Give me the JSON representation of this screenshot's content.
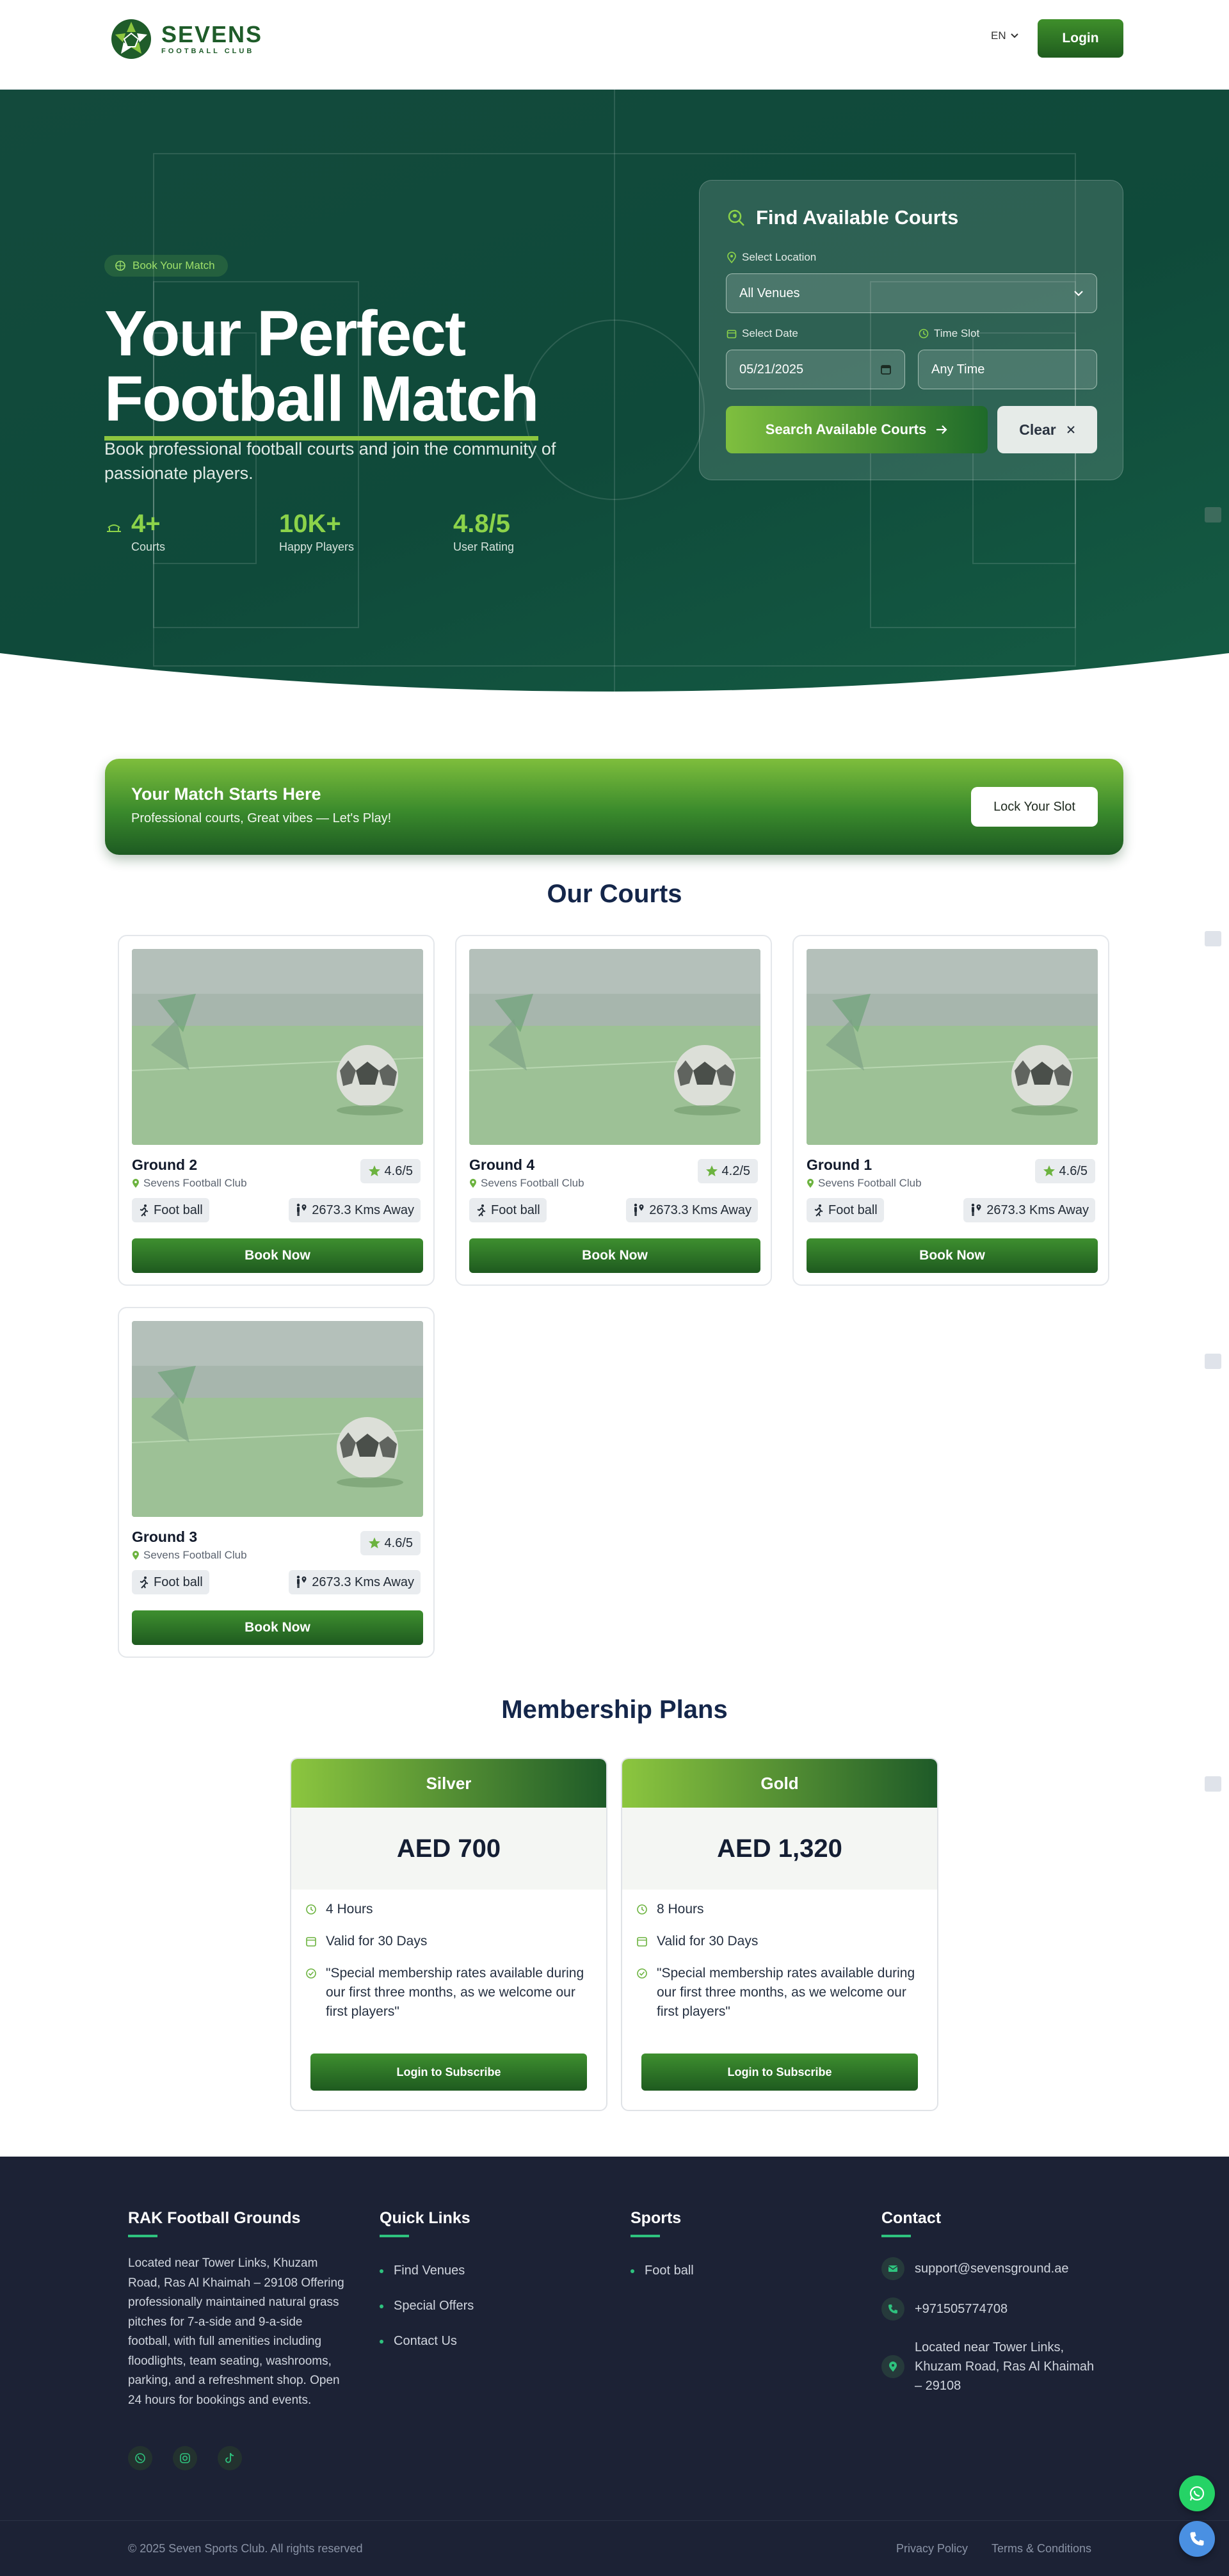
{
  "header": {
    "logo_title": "SEVENS",
    "logo_subtitle": "FOOTBALL CLUB",
    "language": "EN",
    "login_label": "Login"
  },
  "hero": {
    "pill": "Book Your Match",
    "title_line1": "Your Perfect",
    "title_line2": "Football Match",
    "subtitle": "Book professional football courts and join the community of passionate players.",
    "stats": [
      {
        "value": "4+",
        "label": "Courts"
      },
      {
        "value": "10K+",
        "label": "Happy Players"
      },
      {
        "value": "4.8/5",
        "label": "User Rating"
      }
    ]
  },
  "search": {
    "title": "Find Available Courts",
    "location_label": "Select Location",
    "location_value": "All Venues",
    "date_label": "Select Date",
    "date_value": "05/21/2025",
    "time_label": "Time Slot",
    "time_value": "Any Time",
    "search_label": "Search Available Courts",
    "clear_label": "Clear"
  },
  "banner": {
    "heading": "Your Match Starts Here",
    "subtext": "Professional courts, Great vibes — Let's Play!",
    "button": "Lock Your Slot"
  },
  "courts": {
    "title": "Our Courts",
    "items": [
      {
        "name": "Ground 2",
        "club": "Sevens Football Club",
        "rating": "4.6/5",
        "sport": "Foot ball",
        "distance": "2673.3 Kms Away",
        "book": "Book Now"
      },
      {
        "name": "Ground 4",
        "club": "Sevens Football Club",
        "rating": "4.2/5",
        "sport": "Foot ball",
        "distance": "2673.3 Kms Away",
        "book": "Book Now"
      },
      {
        "name": "Ground 1",
        "club": "Sevens Football Club",
        "rating": "4.6/5",
        "sport": "Foot ball",
        "distance": "2673.3 Kms Away",
        "book": "Book Now"
      },
      {
        "name": "Ground 3",
        "club": "Sevens Football Club",
        "rating": "4.6/5",
        "sport": "Foot ball",
        "distance": "2673.3 Kms Away",
        "book": "Book Now"
      }
    ]
  },
  "plans": {
    "title": "Membership Plans",
    "items": [
      {
        "name": "Silver",
        "price": "AED 700",
        "hours": "4 Hours",
        "validity": "Valid for 30 Days",
        "note": "\"Special membership rates available during our first three months, as we welcome our first players\"",
        "button": "Login to Subscribe"
      },
      {
        "name": "Gold",
        "price": "AED 1,320",
        "hours": "8 Hours",
        "validity": "Valid for 30 Days",
        "note": "\"Special membership rates available during our first three months, as we welcome our first players\"",
        "button": "Login to Subscribe"
      }
    ]
  },
  "footer": {
    "about_title": "RAK Football Grounds",
    "about_text": "Located near Tower Links, Khuzam Road, Ras Al Khaimah – 29108 Offering professionally maintained natural grass pitches for 7-a-side and 9-a-side football, with full amenities including floodlights, team seating, washrooms, parking, and a refreshment shop. Open 24 hours for bookings and events.",
    "quick_title": "Quick Links",
    "quick_links": [
      "Find Venues",
      "Special Offers",
      "Contact Us"
    ],
    "sports_title": "Sports",
    "sports": [
      "Foot ball"
    ],
    "contact_title": "Contact",
    "email": "support@sevensground.ae",
    "phone": "+971505774708",
    "address": "Located near Tower Links, Khuzam Road, Ras Al Khaimah – 29108",
    "copyright": "© 2025 Seven Sports Club. All rights reserved",
    "privacy": "Privacy Policy",
    "terms": "Terms & Conditions"
  },
  "colors": {
    "brand_green": "#1f5c2a",
    "accent_lime": "#8cc63f",
    "hero_bg": "#134a3c",
    "footer_bg": "#1c2235",
    "footer_accent": "#2ec27e"
  }
}
